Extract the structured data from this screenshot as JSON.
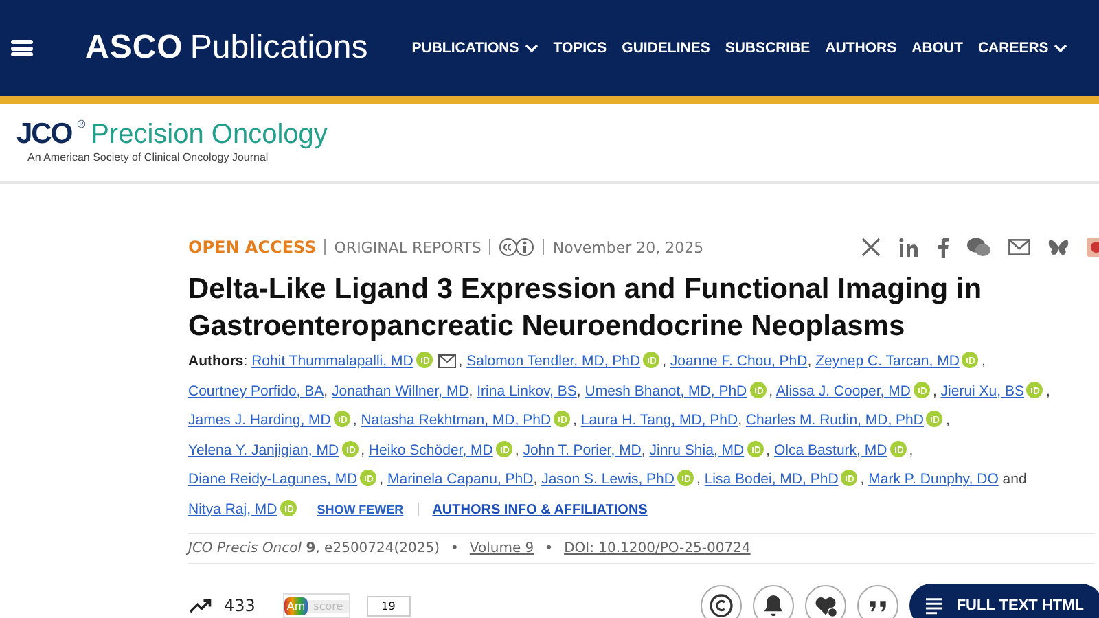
{
  "header": {
    "brand_bold": "ASCO",
    "brand": "Publications",
    "nav": [
      {
        "label": "PUBLICATIONS",
        "dropdown": true
      },
      {
        "label": "TOPICS",
        "dropdown": false
      },
      {
        "label": "GUIDELINES",
        "dropdown": false
      },
      {
        "label": "SUBSCRIBE",
        "dropdown": false
      },
      {
        "label": "AUTHORS",
        "dropdown": false
      },
      {
        "label": "ABOUT",
        "dropdown": false
      },
      {
        "label": "CAREERS",
        "dropdown": true
      }
    ]
  },
  "journal": {
    "abbr": "JCO",
    "mark": "®",
    "name": "Precision Oncology",
    "tagline": "An American Society of Clinical Oncology Journal"
  },
  "article": {
    "access": "OPEN ACCESS",
    "type": "ORIGINAL REPORTS",
    "date": "November 20, 2025",
    "title": "Delta-Like Ligand 3 Expression and Functional Imaging in Gastroenteropancreatic Neuroendocrine Neoplasms",
    "authors_label": "**Authors**:",
    "separator": ",",
    "conjunction": "and",
    "authors": [
      {
        "name": "Rohit Thummalapalli, MD",
        "orcid": true,
        "email": true
      },
      {
        "name": "Salomon Tendler, MD, PhD",
        "orcid": true,
        "email": false
      },
      {
        "name": "Joanne F. Chou, PhD",
        "orcid": false,
        "email": false
      },
      {
        "name": "Zeynep C. Tarcan, MD",
        "orcid": true,
        "email": false
      },
      {
        "name": "Courtney Porfido, BA",
        "orcid": false,
        "email": false
      },
      {
        "name": "Jonathan Willner, MD",
        "orcid": false,
        "email": false
      },
      {
        "name": "Irina Linkov, BS",
        "orcid": false,
        "email": false
      },
      {
        "name": "Umesh Bhanot, MD, PhD",
        "orcid": true,
        "email": false
      },
      {
        "name": "Alissa J. Cooper, MD",
        "orcid": true,
        "email": false
      },
      {
        "name": "Jierui Xu, BS",
        "orcid": true,
        "email": false
      },
      {
        "name": "James J. Harding, MD",
        "orcid": true,
        "email": false
      },
      {
        "name": "Natasha Rekhtman, MD, PhD",
        "orcid": true,
        "email": false
      },
      {
        "name": "Laura H. Tang, MD, PhD",
        "orcid": false,
        "email": false
      },
      {
        "name": "Charles M. Rudin, MD, PhD",
        "orcid": true,
        "email": false
      },
      {
        "name": "Yelena Y. Janjigian, MD",
        "orcid": true,
        "email": false
      },
      {
        "name": "Heiko Schöder, MD",
        "orcid": true,
        "email": false
      },
      {
        "name": "John T. Porier, MD",
        "orcid": false,
        "email": false
      },
      {
        "name": "Jinru Shia, MD",
        "orcid": true,
        "email": false
      },
      {
        "name": "Olca Basturk, MD",
        "orcid": true,
        "email": false
      },
      {
        "name": "Diane Reidy-Lagunes, MD",
        "orcid": true,
        "email": false
      },
      {
        "name": "Marinela Capanu, PhD",
        "orcid": false,
        "email": false
      },
      {
        "name": "Jason S. Lewis, PhD",
        "orcid": true,
        "email": false
      },
      {
        "name": "Lisa Bodei, MD, PhD",
        "orcid": true,
        "email": false
      },
      {
        "name": "Mark P. Dunphy, DO",
        "orcid": false,
        "email": false
      },
      {
        "name": "Nitya Raj, MD",
        "orcid": true,
        "email": false
      }
    ],
    "show_fewer": "SHOW FEWER",
    "affiliations": "AUTHORS INFO & AFFILIATIONS",
    "citation": {
      "bullet": "•",
      "journal": "JCO Precis Oncol",
      "volume_num": "9",
      "rest": ", e2500724(2025)",
      "volume": "Volume 9",
      "doi": "DOI: 10.1200/PO-25-00724"
    }
  },
  "metrics": {
    "views": "433",
    "altmetric_label": "Am",
    "altmetric_word": "score",
    "citations": "19"
  },
  "full_text_button": "FULL TEXT HTML"
}
